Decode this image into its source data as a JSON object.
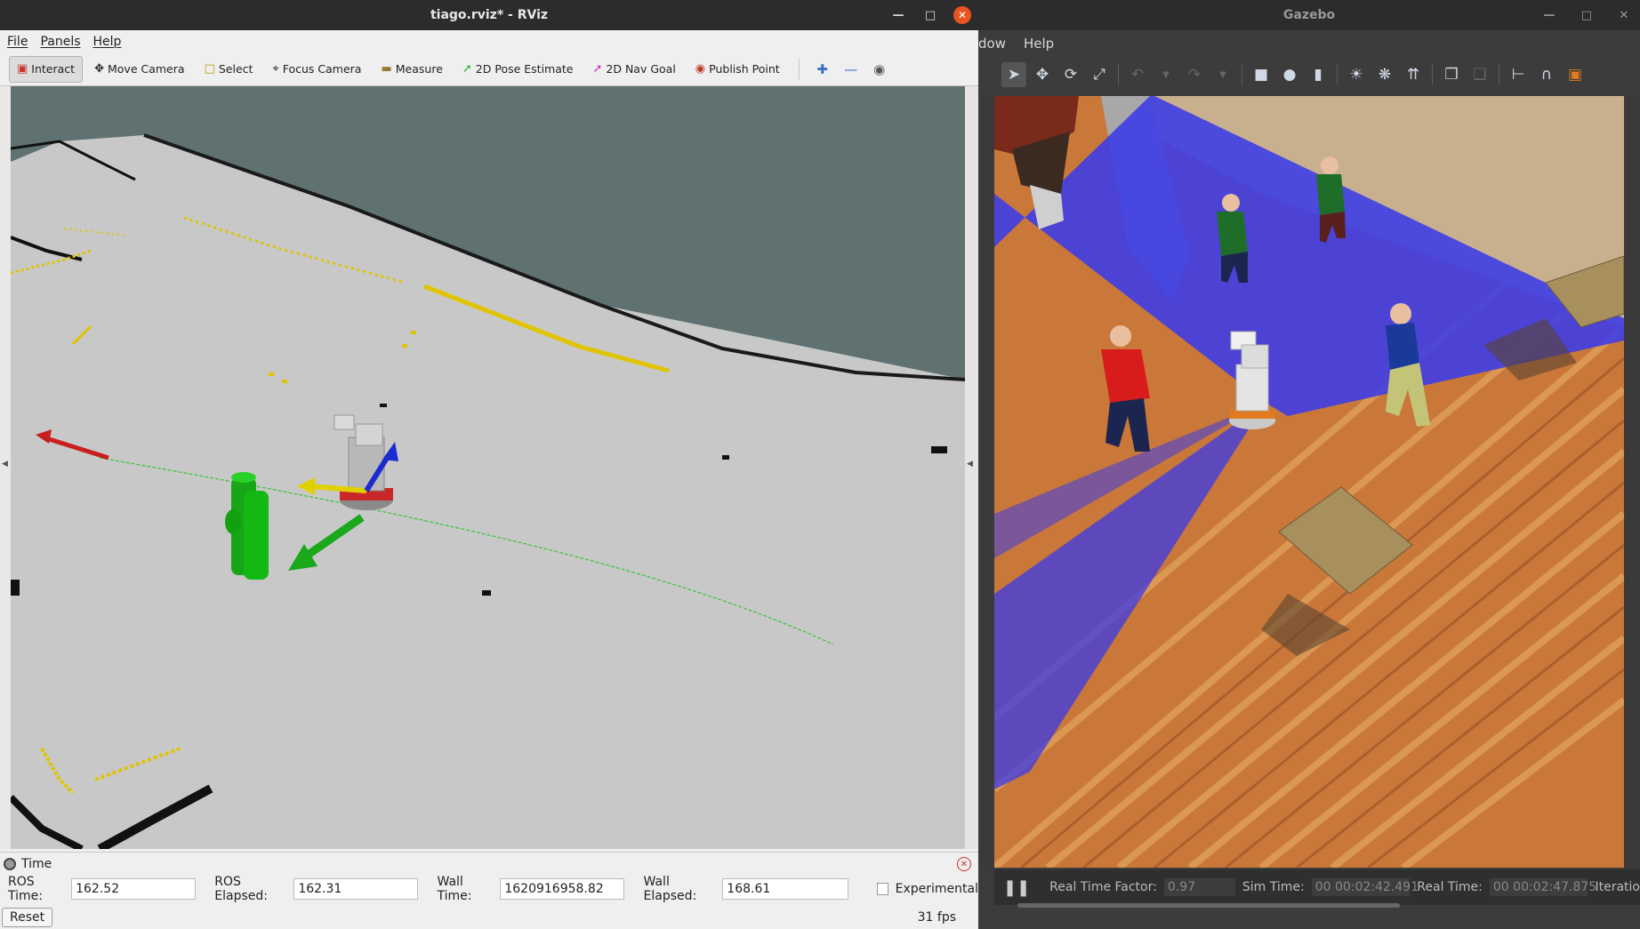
{
  "rviz": {
    "title": "tiago.rviz* - RViz",
    "menu": {
      "file": "File",
      "panels": "Panels",
      "help": "Help"
    },
    "toolbar": {
      "interact": "Interact",
      "move_camera": "Move Camera",
      "select": "Select",
      "focus_camera": "Focus Camera",
      "measure": "Measure",
      "pose_estimate": "2D Pose Estimate",
      "nav_goal": "2D Nav Goal",
      "publish_point": "Publish Point"
    },
    "time_panel": {
      "title": "Time",
      "ros_time_label": "ROS Time:",
      "ros_time": "162.52",
      "ros_elapsed_label": "ROS Elapsed:",
      "ros_elapsed": "162.31",
      "wall_time_label": "Wall Time:",
      "wall_time": "1620916958.82",
      "wall_elapsed_label": "Wall Elapsed:",
      "wall_elapsed": "168.61",
      "experimental_label": "Experimental",
      "reset_label": "Reset",
      "fps": "31 fps"
    }
  },
  "gazebo": {
    "title": "Gazebo",
    "menu": {
      "window_partial": "dow",
      "help": "Help"
    },
    "status": {
      "real_time_factor_label": "Real Time Factor:",
      "real_time_factor": "0.97",
      "sim_time_label": "Sim Time:",
      "sim_time": "00 00:02:42.491",
      "real_time_label": "Real Time:",
      "real_time": "00 00:02:47.875",
      "iterations_label": "Iteratio"
    }
  },
  "colors": {
    "titlebar": "#2c2c2c",
    "close_button": "#e95420",
    "map_unknown": "#5f7271",
    "map_free": "#c8c8c8",
    "laser_plane": "#3c3ce6"
  }
}
